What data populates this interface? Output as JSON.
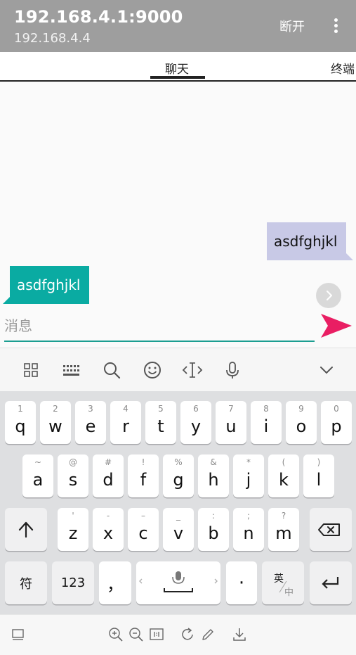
{
  "header": {
    "title": "192.168.4.1:9000",
    "subtitle": "192.168.4.4",
    "disconnect_label": "断开"
  },
  "tabs": [
    {
      "label": "聊天",
      "active": true
    },
    {
      "label": "终端",
      "active": false
    }
  ],
  "chat": {
    "messages": [
      {
        "direction": "outgoing",
        "text": "asdfghjkl"
      },
      {
        "direction": "incoming",
        "text": "asdfghjkl"
      }
    ],
    "input": {
      "value": "",
      "placeholder": "消息"
    }
  },
  "colors": {
    "titlebar": "#9e9e9e",
    "outgoing_bubble": "#c8c9e6",
    "incoming_bubble": "#0aaba2",
    "input_underline": "#1c9e91",
    "send_accent": "#e91e63"
  },
  "keyboard": {
    "toolbar_icons": [
      "grid-icon",
      "keyboard-icon",
      "search-icon",
      "emoji-icon",
      "cursor-icon",
      "mic-icon",
      "chevron-down-icon"
    ],
    "row1": [
      {
        "sub": "1",
        "main": "q"
      },
      {
        "sub": "2",
        "main": "w"
      },
      {
        "sub": "3",
        "main": "e"
      },
      {
        "sub": "4",
        "main": "r"
      },
      {
        "sub": "5",
        "main": "t"
      },
      {
        "sub": "6",
        "main": "y"
      },
      {
        "sub": "7",
        "main": "u"
      },
      {
        "sub": "8",
        "main": "i"
      },
      {
        "sub": "9",
        "main": "o"
      },
      {
        "sub": "0",
        "main": "p"
      }
    ],
    "row2": [
      {
        "sub": "~",
        "main": "a"
      },
      {
        "sub": "@",
        "main": "s"
      },
      {
        "sub": "#",
        "main": "d"
      },
      {
        "sub": "!",
        "main": "f"
      },
      {
        "sub": "%",
        "main": "g"
      },
      {
        "sub": "&",
        "main": "h"
      },
      {
        "sub": "*",
        "main": "j"
      },
      {
        "sub": "(",
        "main": "k"
      },
      {
        "sub": ")",
        "main": "l"
      }
    ],
    "row3": [
      {
        "sub": "'",
        "main": "z"
      },
      {
        "sub": "-",
        "main": "x"
      },
      {
        "sub": "–",
        "main": "c"
      },
      {
        "sub": "_",
        "main": "v"
      },
      {
        "sub": ":",
        "main": "b"
      },
      {
        "sub": ";",
        "main": "n"
      },
      {
        "sub": "?",
        "main": "m"
      }
    ],
    "symbols_label": "符",
    "numbers_label": "123",
    "comma_label": "，",
    "period_label": "·",
    "lang_label_top": "英",
    "lang_label_bottom": "中"
  },
  "bottom_toolbar": [
    "keyboard-toggle-icon",
    "zoom-in-icon",
    "zoom-out-icon",
    "one-to-one-icon",
    "rotate-icon",
    "edit-icon",
    "download-icon"
  ]
}
